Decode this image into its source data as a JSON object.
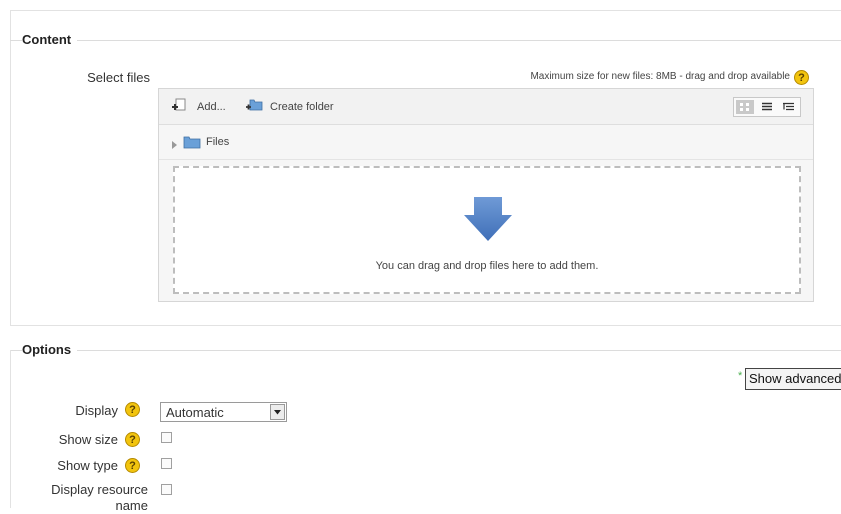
{
  "content_section": {
    "legend": "Content",
    "select_files_label": "Select files",
    "max_size_text": "Maximum size for new files: 8MB - drag and drop available",
    "help_glyph": "?"
  },
  "filepicker": {
    "add_label": "Add...",
    "create_folder_label": "Create folder",
    "folder_name": "Files",
    "dropzone_text": "You can drag and drop files here to add them.",
    "view_modes": [
      "icons-view",
      "list-view",
      "tree-view"
    ],
    "active_view": "icons-view"
  },
  "options_section": {
    "legend": "Options",
    "required_marker": "*",
    "show_advanced_label": "Show advanced",
    "display_label": "Display",
    "display_value": "Automatic",
    "show_size_label": "Show size",
    "show_type_label": "Show type",
    "display_resource_label_1": "Display resource",
    "display_resource_label_2": "name"
  },
  "colors": {
    "help_icon": "#f2c40e",
    "arrow": "#4f81c7",
    "folder": "#6aa0d8",
    "required_marker": "#4caf50"
  }
}
